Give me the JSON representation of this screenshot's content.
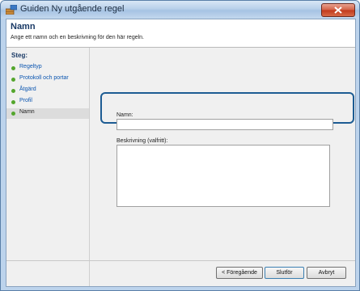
{
  "window": {
    "title": "Guiden Ny utgående regel"
  },
  "header": {
    "title": "Namn",
    "description": "Ange ett namn och en beskrivning för den här regeln."
  },
  "steps": {
    "title": "Steg:",
    "items": [
      {
        "label": "Regeltyp"
      },
      {
        "label": "Protokoll och portar"
      },
      {
        "label": "Åtgärd"
      },
      {
        "label": "Profil"
      },
      {
        "label": "Namn"
      }
    ]
  },
  "form": {
    "name_label": "Namn:",
    "name_value": "",
    "description_label": "Beskrivning (valfritt):",
    "description_value": ""
  },
  "buttons": {
    "back": "< Föregående",
    "finish": "Slutför",
    "cancel": "Avbryt"
  },
  "colors": {
    "accent": "#1d5c93",
    "step_dot": "#54a62d",
    "link": "#0a55b0"
  }
}
